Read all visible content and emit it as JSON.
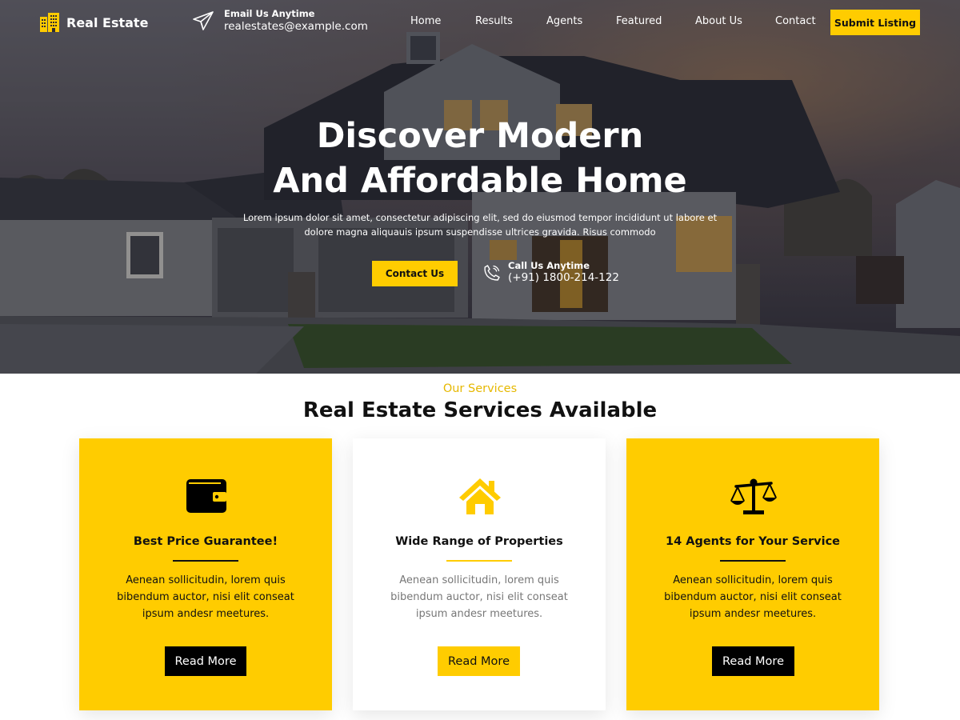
{
  "brand": {
    "name": "Real Estate",
    "accent_color": "#ffcc00",
    "logo_icon": "building-icon"
  },
  "header": {
    "email_label": "Email Us Anytime",
    "email_value": "realestates@example.com",
    "email_icon": "paper-plane-icon",
    "nav": [
      {
        "label": "Home"
      },
      {
        "label": "Results"
      },
      {
        "label": "Agents"
      },
      {
        "label": "Featured"
      },
      {
        "label": "About Us"
      },
      {
        "label": "Contact"
      }
    ],
    "submit_label": "Submit Listing"
  },
  "hero": {
    "title_line1": "Discover Modern",
    "title_line2": "And Affordable Home",
    "description": "Lorem ipsum dolor sit amet, consectetur adipiscing elit, sed do eiusmod tempor incididunt ut labore et dolore magna aliquauis ipsum suspendisse ultrices gravida. Risus commodo",
    "contact_button": "Contact Us",
    "call_label": "Call Us Anytime",
    "call_value": "(+91) 1800-214-122",
    "call_icon": "phone-icon"
  },
  "services": {
    "eyebrow": "Our Services",
    "title": "Real Estate Services Available",
    "cards": [
      {
        "icon": "wallet-icon",
        "title": "Best Price Guarantee!",
        "text": "Aenean sollicitudin, lorem quis bibendum auctor, nisi elit conseat ipsum andesr meetures.",
        "button": "Read More",
        "background": "#ffcc00"
      },
      {
        "icon": "house-icon",
        "title": "Wide Range of Properties",
        "text": "Aenean sollicitudin, lorem quis bibendum auctor, nisi elit conseat ipsum andesr meetures.",
        "button": "Read More",
        "background": "#ffffff"
      },
      {
        "icon": "balance-scale-icon",
        "title": "14 Agents for Your Service",
        "text": "Aenean sollicitudin, lorem quis bibendum auctor, nisi elit conseat ipsum andesr meetures.",
        "button": "Read More",
        "background": "#ffcc00"
      }
    ]
  }
}
